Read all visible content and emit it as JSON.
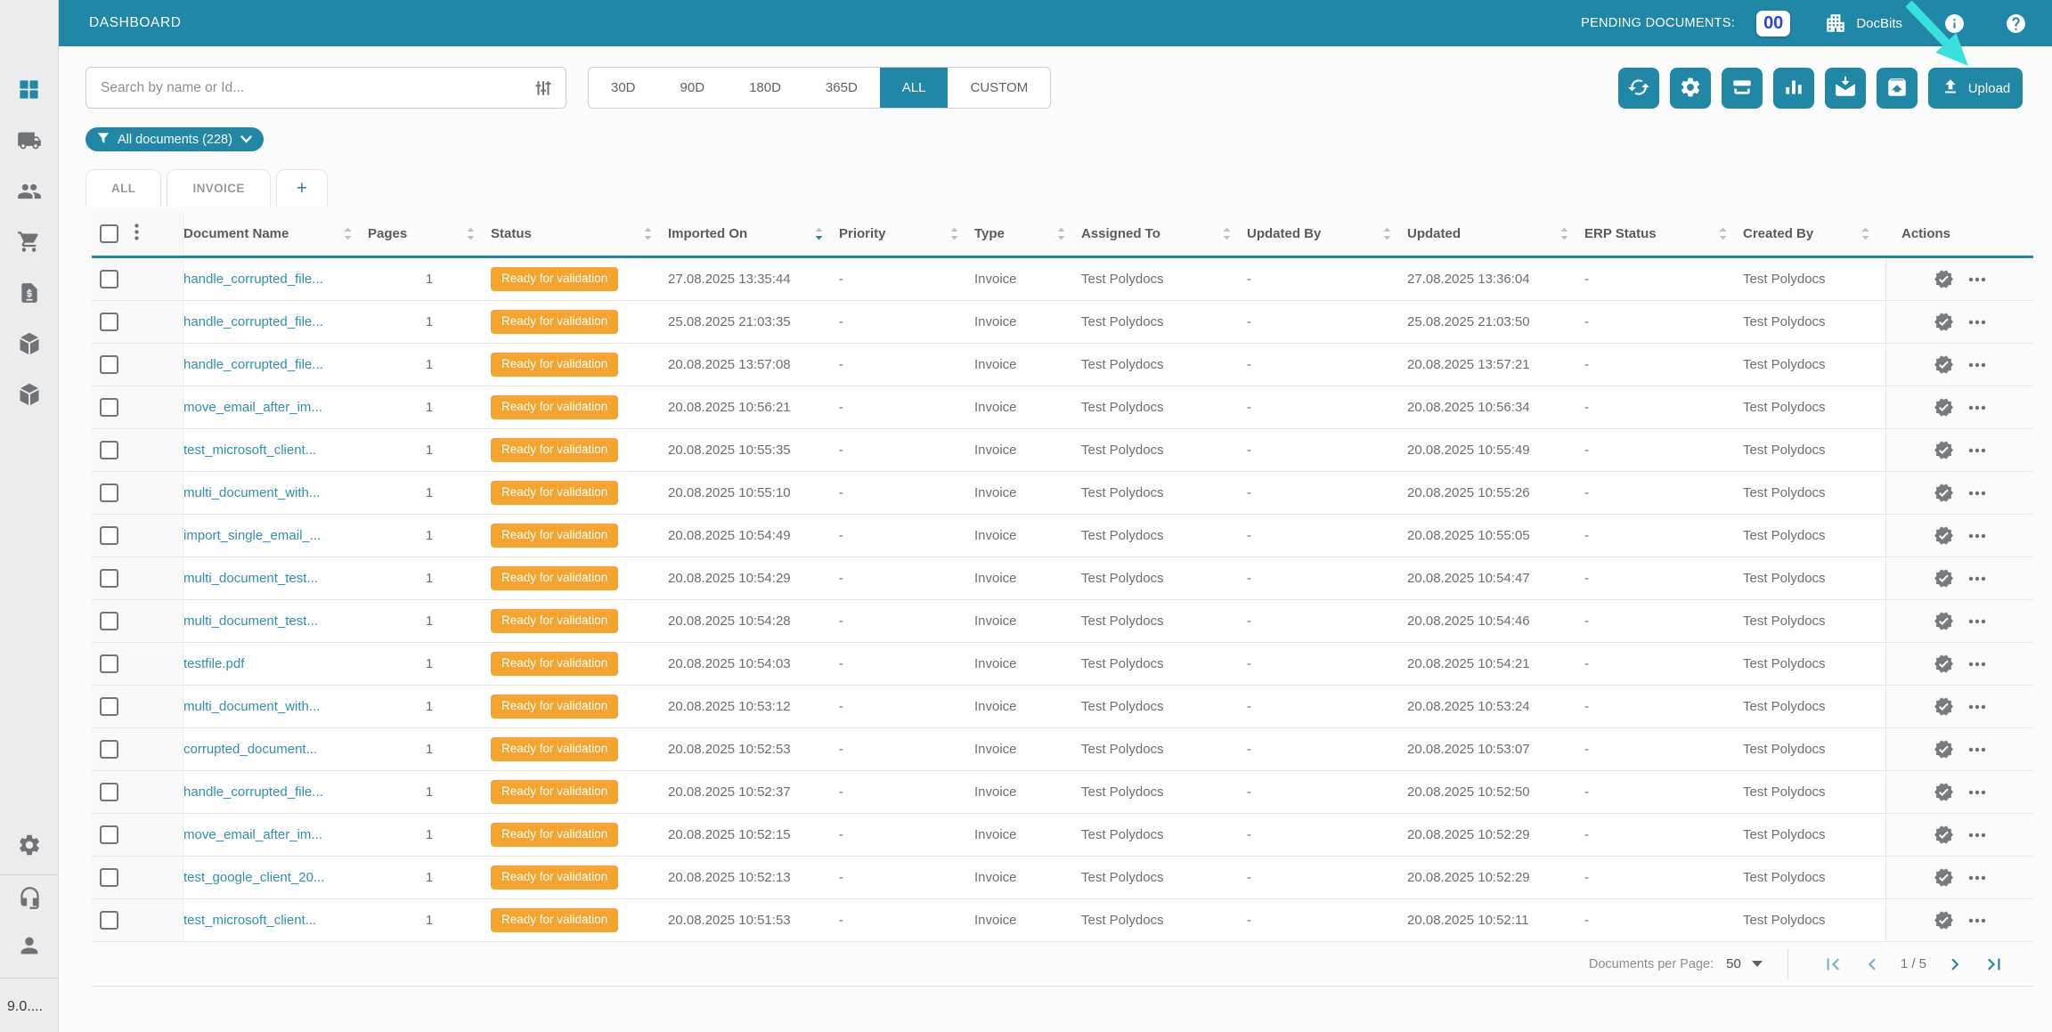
{
  "colors": {
    "primary_teal": "#2187A7",
    "status_orange": "#F5A42D",
    "pending_count_blue": "#2B46D3",
    "tutorial_cursor_cyan": "#38E1DE",
    "link_teal": "#2E8FB3"
  },
  "header": {
    "title": "DASHBOARD",
    "pending_label": "PENDING DOCUMENTS:",
    "pending_count": "00",
    "brand": "DocBits",
    "icons": [
      "company-icon",
      "info-icon",
      "help-icon"
    ]
  },
  "sidebar": {
    "version": "9.0....",
    "items": [
      "dashboard",
      "shipping",
      "contacts",
      "purchase-orders",
      "invoices",
      "package",
      "package",
      "settings",
      "support",
      "profile"
    ],
    "active_item": "dashboard"
  },
  "toolbar": {
    "search_placeholder": "Search by name or Id...",
    "date_ranges": [
      "30D",
      "90D",
      "180D",
      "365D",
      "ALL",
      "CUSTOM"
    ],
    "active_range": "ALL",
    "buttons": [
      "refresh",
      "settings",
      "scanner",
      "statistics",
      "mail-import",
      "export",
      "upload"
    ],
    "upload_label": "Upload"
  },
  "filter_chip": {
    "label": "All documents (228)"
  },
  "tabs": [
    {
      "label": "ALL",
      "active": true
    },
    {
      "label": "INVOICE",
      "active": false
    },
    {
      "label": "+",
      "active": false
    }
  ],
  "table": {
    "columns": [
      {
        "id": "document_name",
        "label": "Document Name",
        "sortable": true,
        "sorted": null
      },
      {
        "id": "pages",
        "label": "Pages",
        "sortable": true,
        "sorted": null
      },
      {
        "id": "status",
        "label": "Status",
        "sortable": true,
        "sorted": null
      },
      {
        "id": "imported_on",
        "label": "Imported On",
        "sortable": true,
        "sorted": "desc"
      },
      {
        "id": "priority",
        "label": "Priority",
        "sortable": true,
        "sorted": null
      },
      {
        "id": "type",
        "label": "Type",
        "sortable": true,
        "sorted": null
      },
      {
        "id": "assigned_to",
        "label": "Assigned To",
        "sortable": true,
        "sorted": null
      },
      {
        "id": "updated_by",
        "label": "Updated By",
        "sortable": true,
        "sorted": null
      },
      {
        "id": "updated",
        "label": "Updated",
        "sortable": true,
        "sorted": null
      },
      {
        "id": "erp_status",
        "label": "ERP Status",
        "sortable": true,
        "sorted": null
      },
      {
        "id": "created_by",
        "label": "Created By",
        "sortable": true,
        "sorted": null
      },
      {
        "id": "actions",
        "label": "Actions",
        "sortable": false,
        "sorted": null
      }
    ],
    "rows": [
      {
        "name": "handle_corrupted_file...",
        "pages": "1",
        "status": "Ready for validation",
        "imported": "27.08.2025 13:35:44",
        "priority": "-",
        "type": "Invoice",
        "assigned": "Test Polydocs",
        "updated_by": "-",
        "updated": "27.08.2025 13:36:04",
        "erp": "-",
        "created_by": "Test Polydocs"
      },
      {
        "name": "handle_corrupted_file...",
        "pages": "1",
        "status": "Ready for validation",
        "imported": "25.08.2025 21:03:35",
        "priority": "-",
        "type": "Invoice",
        "assigned": "Test Polydocs",
        "updated_by": "-",
        "updated": "25.08.2025 21:03:50",
        "erp": "-",
        "created_by": "Test Polydocs"
      },
      {
        "name": "handle_corrupted_file...",
        "pages": "1",
        "status": "Ready for validation",
        "imported": "20.08.2025 13:57:08",
        "priority": "-",
        "type": "Invoice",
        "assigned": "Test Polydocs",
        "updated_by": "-",
        "updated": "20.08.2025 13:57:21",
        "erp": "-",
        "created_by": "Test Polydocs"
      },
      {
        "name": "move_email_after_im...",
        "pages": "1",
        "status": "Ready for validation",
        "imported": "20.08.2025 10:56:21",
        "priority": "-",
        "type": "Invoice",
        "assigned": "Test Polydocs",
        "updated_by": "-",
        "updated": "20.08.2025 10:56:34",
        "erp": "-",
        "created_by": "Test Polydocs"
      },
      {
        "name": "test_microsoft_client...",
        "pages": "1",
        "status": "Ready for validation",
        "imported": "20.08.2025 10:55:35",
        "priority": "-",
        "type": "Invoice",
        "assigned": "Test Polydocs",
        "updated_by": "-",
        "updated": "20.08.2025 10:55:49",
        "erp": "-",
        "created_by": "Test Polydocs"
      },
      {
        "name": "multi_document_with...",
        "pages": "1",
        "status": "Ready for validation",
        "imported": "20.08.2025 10:55:10",
        "priority": "-",
        "type": "Invoice",
        "assigned": "Test Polydocs",
        "updated_by": "-",
        "updated": "20.08.2025 10:55:26",
        "erp": "-",
        "created_by": "Test Polydocs"
      },
      {
        "name": "import_single_email_...",
        "pages": "1",
        "status": "Ready for validation",
        "imported": "20.08.2025 10:54:49",
        "priority": "-",
        "type": "Invoice",
        "assigned": "Test Polydocs",
        "updated_by": "-",
        "updated": "20.08.2025 10:55:05",
        "erp": "-",
        "created_by": "Test Polydocs"
      },
      {
        "name": "multi_document_test...",
        "pages": "1",
        "status": "Ready for validation",
        "imported": "20.08.2025 10:54:29",
        "priority": "-",
        "type": "Invoice",
        "assigned": "Test Polydocs",
        "updated_by": "-",
        "updated": "20.08.2025 10:54:47",
        "erp": "-",
        "created_by": "Test Polydocs"
      },
      {
        "name": "multi_document_test...",
        "pages": "1",
        "status": "Ready for validation",
        "imported": "20.08.2025 10:54:28",
        "priority": "-",
        "type": "Invoice",
        "assigned": "Test Polydocs",
        "updated_by": "-",
        "updated": "20.08.2025 10:54:46",
        "erp": "-",
        "created_by": "Test Polydocs"
      },
      {
        "name": "testfile.pdf",
        "pages": "1",
        "status": "Ready for validation",
        "imported": "20.08.2025 10:54:03",
        "priority": "-",
        "type": "Invoice",
        "assigned": "Test Polydocs",
        "updated_by": "-",
        "updated": "20.08.2025 10:54:21",
        "erp": "-",
        "created_by": "Test Polydocs"
      },
      {
        "name": "multi_document_with...",
        "pages": "1",
        "status": "Ready for validation",
        "imported": "20.08.2025 10:53:12",
        "priority": "-",
        "type": "Invoice",
        "assigned": "Test Polydocs",
        "updated_by": "-",
        "updated": "20.08.2025 10:53:24",
        "erp": "-",
        "created_by": "Test Polydocs"
      },
      {
        "name": "corrupted_document...",
        "pages": "1",
        "status": "Ready for validation",
        "imported": "20.08.2025 10:52:53",
        "priority": "-",
        "type": "Invoice",
        "assigned": "Test Polydocs",
        "updated_by": "-",
        "updated": "20.08.2025 10:53:07",
        "erp": "-",
        "created_by": "Test Polydocs"
      },
      {
        "name": "handle_corrupted_file...",
        "pages": "1",
        "status": "Ready for validation",
        "imported": "20.08.2025 10:52:37",
        "priority": "-",
        "type": "Invoice",
        "assigned": "Test Polydocs",
        "updated_by": "-",
        "updated": "20.08.2025 10:52:50",
        "erp": "-",
        "created_by": "Test Polydocs"
      },
      {
        "name": "move_email_after_im...",
        "pages": "1",
        "status": "Ready for validation",
        "imported": "20.08.2025 10:52:15",
        "priority": "-",
        "type": "Invoice",
        "assigned": "Test Polydocs",
        "updated_by": "-",
        "updated": "20.08.2025 10:52:29",
        "erp": "-",
        "created_by": "Test Polydocs"
      },
      {
        "name": "test_google_client_20...",
        "pages": "1",
        "status": "Ready for validation",
        "imported": "20.08.2025 10:52:13",
        "priority": "-",
        "type": "Invoice",
        "assigned": "Test Polydocs",
        "updated_by": "-",
        "updated": "20.08.2025 10:52:29",
        "erp": "-",
        "created_by": "Test Polydocs"
      },
      {
        "name": "test_microsoft_client...",
        "pages": "1",
        "status": "Ready for validation",
        "imported": "20.08.2025 10:51:53",
        "priority": "-",
        "type": "Invoice",
        "assigned": "Test Polydocs",
        "updated_by": "-",
        "updated": "20.08.2025 10:52:11",
        "erp": "-",
        "created_by": "Test Polydocs"
      }
    ]
  },
  "pagination": {
    "per_page_label": "Documents per Page:",
    "per_page_value": "50",
    "page_indicator": "1 / 5"
  }
}
